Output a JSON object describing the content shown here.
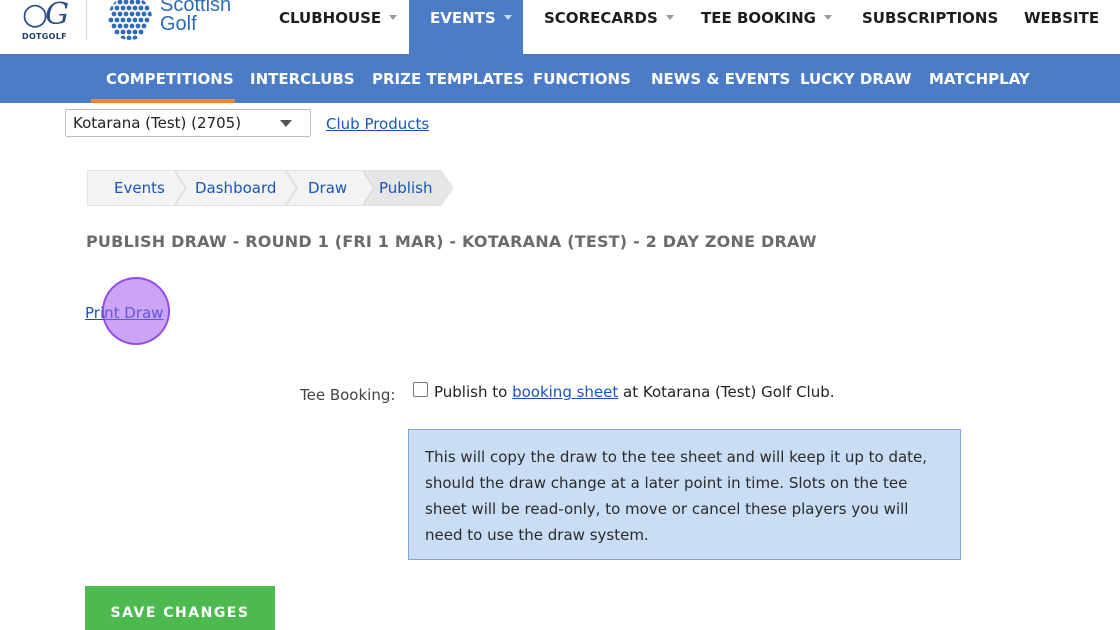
{
  "brand": {
    "dotgolf_label": "DOTGOLF",
    "scottish_golf_line1": "Scottish",
    "scottish_golf_line2": "Golf"
  },
  "topnav": {
    "items": [
      {
        "label": "CLUBHOUSE",
        "dropdown": true
      },
      {
        "label": "EVENTS",
        "dropdown": true,
        "active": true
      },
      {
        "label": "SCORECARDS",
        "dropdown": true
      },
      {
        "label": "TEE BOOKING",
        "dropdown": true
      },
      {
        "label": "SUBSCRIPTIONS",
        "dropdown": false
      },
      {
        "label": "WEBSITE",
        "dropdown": false
      }
    ]
  },
  "subnav": {
    "items": [
      {
        "label": "COMPETITIONS",
        "active": true
      },
      {
        "label": "INTERCLUBS"
      },
      {
        "label": "PRIZE TEMPLATES"
      },
      {
        "label": "FUNCTIONS"
      },
      {
        "label": "NEWS & EVENTS"
      },
      {
        "label": "LUCKY DRAW"
      },
      {
        "label": "MATCHPLAY"
      }
    ]
  },
  "club_selector": {
    "selected": "Kotarana (Test) (2705)"
  },
  "club_products_link": "Club Products",
  "breadcrumb": {
    "items": [
      "Events",
      "Dashboard",
      "Draw",
      "Publish"
    ]
  },
  "page_title": "PUBLISH DRAW - ROUND 1 (FRI 1 MAR) - KOTARANA (TEST) - 2 DAY ZONE DRAW",
  "print_draw_link": "Print Draw",
  "tee_booking": {
    "label": "Tee Booking:",
    "checked": false,
    "prefix": "Publish to",
    "link": "booking sheet",
    "suffix": "at Kotarana (Test) Golf Club."
  },
  "info_text": "This will copy the draw to the tee sheet and will keep it up to date, should the draw change at a later point in time. Slots on the tee sheet will be read-only, to move or cancel these players you will need to use the draw system.",
  "save_button_label": "SAVE CHANGES",
  "colors": {
    "nav_blue": "#4a7cc7",
    "active_underline": "#e58a3a",
    "link": "#1a55b5",
    "info_bg": "#c9ddf5",
    "save_green": "#4cba4f"
  }
}
